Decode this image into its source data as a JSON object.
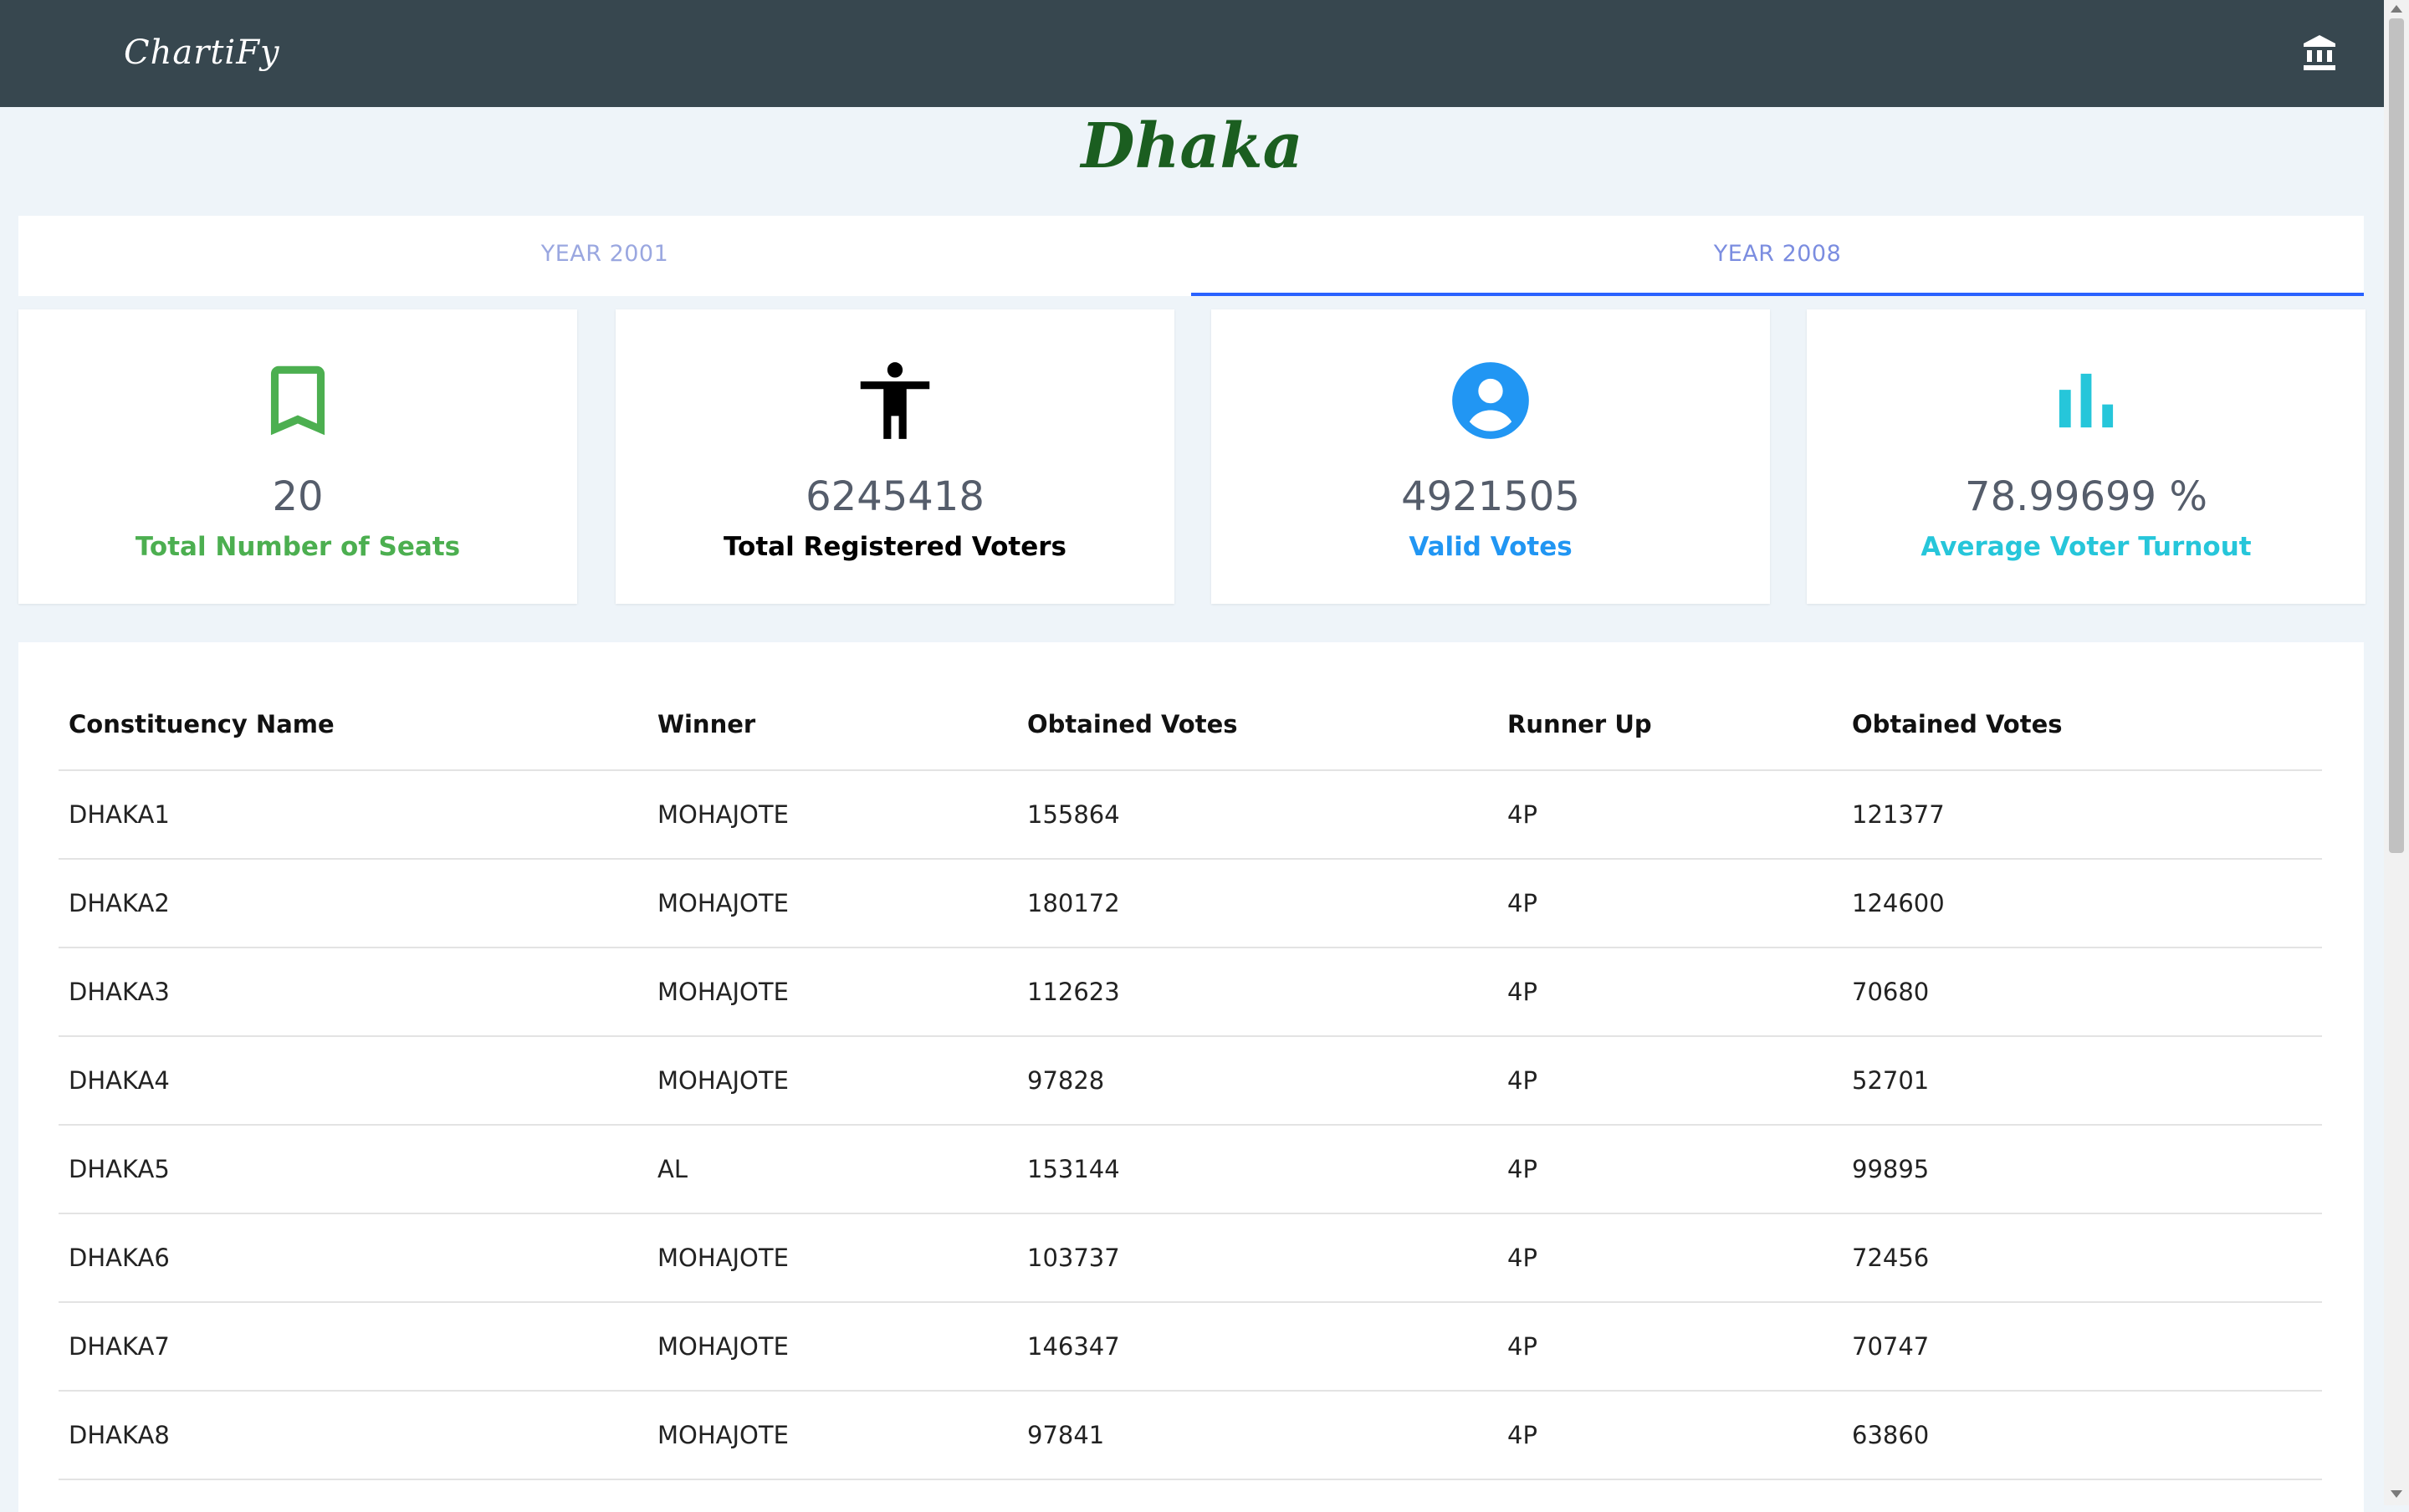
{
  "navbar": {
    "brand": "ChartiFy",
    "icon": "bank-icon"
  },
  "page": {
    "title": "Dhaka"
  },
  "tabs": [
    {
      "label": "YEAR 2001",
      "active": false
    },
    {
      "label": "YEAR 2008",
      "active": true
    }
  ],
  "stats": [
    {
      "value": "20",
      "label": "Total Number of Seats",
      "icon": "bookmark-icon",
      "color": "#4caf50"
    },
    {
      "value": "6245418",
      "label": "Total Registered Voters",
      "icon": "accessibility-icon",
      "color": "#000000"
    },
    {
      "value": "4921505",
      "label": "Valid Votes",
      "icon": "account-circle-icon",
      "color": "#2196f3"
    },
    {
      "value": "78.99699 %",
      "label": "Average Voter Turnout",
      "icon": "bar-chart-icon",
      "color": "#26c6da"
    }
  ],
  "table": {
    "headers": [
      "Constituency Name",
      "Winner",
      "Obtained Votes",
      "Runner Up",
      "Obtained Votes"
    ],
    "rows": [
      [
        "DHAKA1",
        "MOHAJOTE",
        "155864",
        "4P",
        "121377"
      ],
      [
        "DHAKA2",
        "MOHAJOTE",
        "180172",
        "4P",
        "124600"
      ],
      [
        "DHAKA3",
        "MOHAJOTE",
        "112623",
        "4P",
        "70680"
      ],
      [
        "DHAKA4",
        "MOHAJOTE",
        "97828",
        "4P",
        "52701"
      ],
      [
        "DHAKA5",
        "AL",
        "153144",
        "4P",
        "99895"
      ],
      [
        "DHAKA6",
        "MOHAJOTE",
        "103737",
        "4P",
        "72456"
      ],
      [
        "DHAKA7",
        "MOHAJOTE",
        "146347",
        "4P",
        "70747"
      ],
      [
        "DHAKA8",
        "MOHAJOTE",
        "97841",
        "4P",
        "63860"
      ]
    ]
  }
}
